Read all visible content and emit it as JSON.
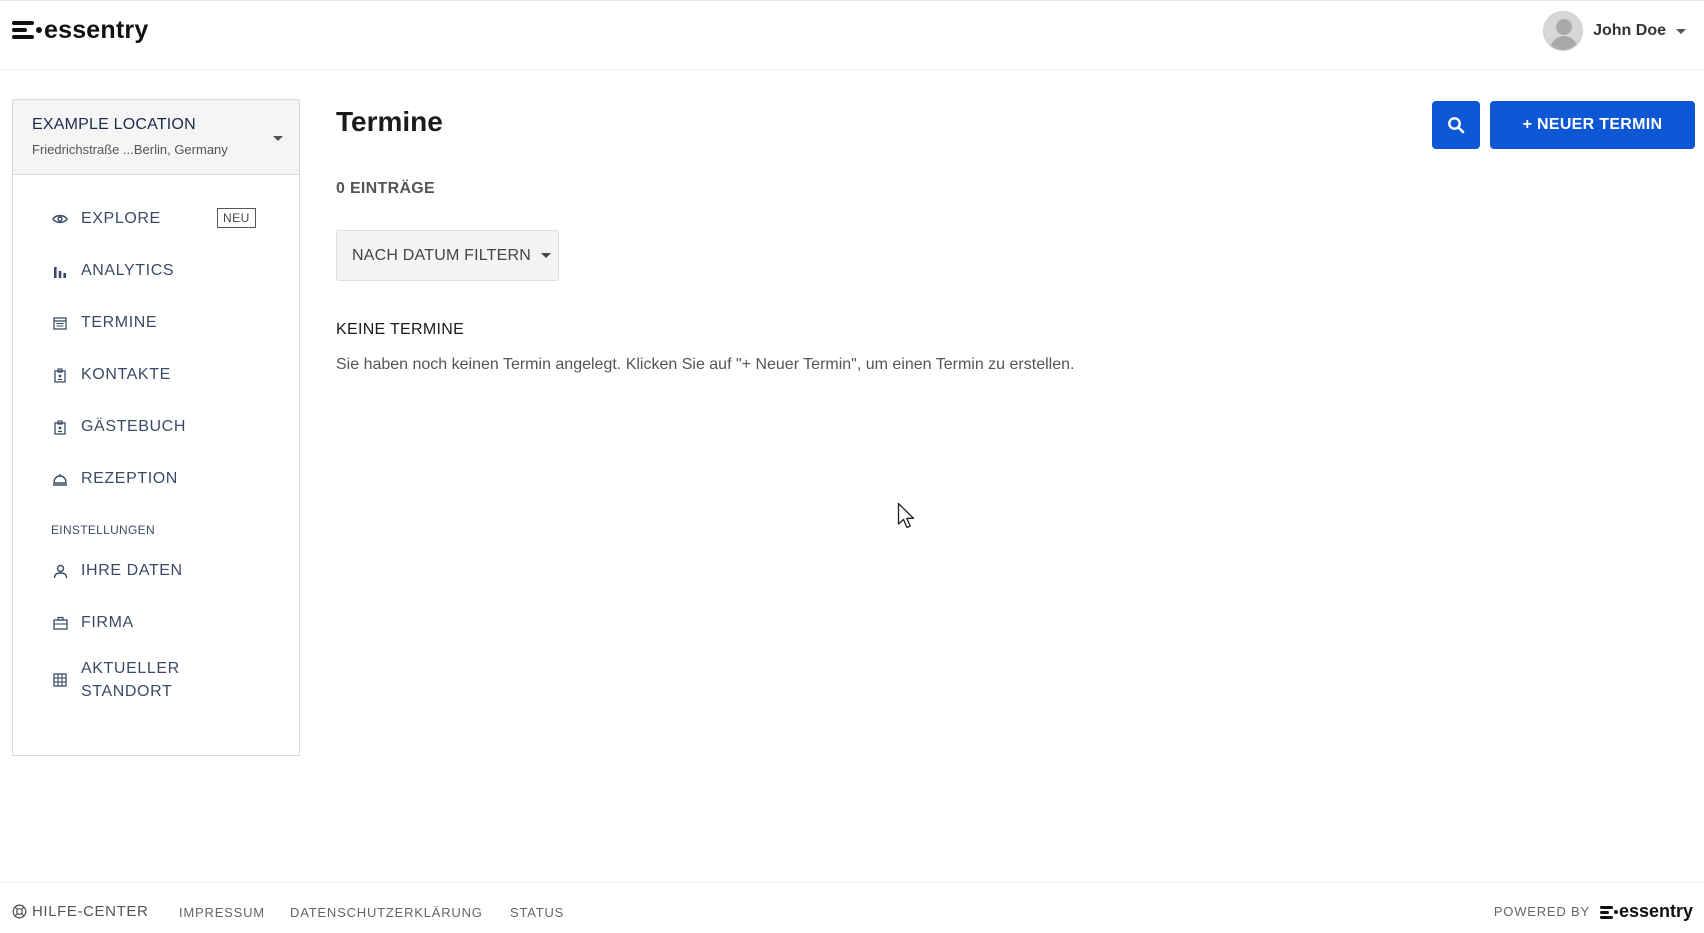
{
  "header": {
    "logo_text": "essentry",
    "user_name": "John Doe"
  },
  "location": {
    "name": "EXAMPLE LOCATION",
    "address": "Friedrichstraße ...Berlin, Germany"
  },
  "sidebar": {
    "items": [
      {
        "label": "EXPLORE",
        "icon": "eye-icon",
        "badge": "NEU"
      },
      {
        "label": "ANALYTICS",
        "icon": "bar-chart-icon"
      },
      {
        "label": "TERMINE",
        "icon": "calendar-icon"
      },
      {
        "label": "KONTAKTE",
        "icon": "badge-icon"
      },
      {
        "label": "GÄSTEBUCH",
        "icon": "badge-icon"
      },
      {
        "label": "REZEPTION",
        "icon": "bell-icon"
      }
    ],
    "settings_title": "EINSTELLUNGEN",
    "settings_items": [
      {
        "label": "IHRE DATEN",
        "icon": "person-icon"
      },
      {
        "label": "FIRMA",
        "icon": "briefcase-icon"
      },
      {
        "label": "AKTUELLER STANDORT",
        "icon": "building-icon"
      }
    ]
  },
  "main": {
    "title": "Termine",
    "new_button": "+ NEUER TERMIN",
    "search_icon": "search-icon",
    "count": "0 EINTRÄGE",
    "filter_label": "NACH DATUM FILTERN",
    "empty_title": "KEINE TERMINE",
    "empty_text": "Sie haben noch keinen Termin angelegt. Klicken Sie auf \"+ Neuer Termin\", um einen Termin zu erstellen."
  },
  "footer": {
    "help": "HILFE-CENTER",
    "links": [
      "IMPRESSUM",
      "DATENSCHUTZERKLÄRUNG",
      "STATUS"
    ],
    "powered_by": "POWERED BY",
    "brand": "essentry"
  },
  "colors": {
    "primary": "#0d57d4",
    "nav_text": "#3a4a66"
  }
}
